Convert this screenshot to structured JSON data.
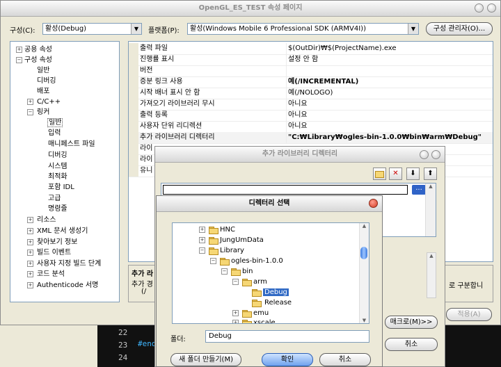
{
  "main_window": {
    "title": "OpenGL_ES_TEST 속성 페이지",
    "config_label": "구성(C):",
    "config_value": "활성(Debug)",
    "platform_label": "플랫폼(P):",
    "platform_value": "활성(Windows Mobile 6 Professional SDK (ARMV4I))",
    "config_manager_label": "구성 관리자(O)...",
    "apply_label": "적용(A)"
  },
  "tree": {
    "items": [
      {
        "label": "공용 속성",
        "toggle": "+"
      },
      {
        "label": "구성 속성",
        "toggle": "-"
      },
      {
        "label": "일반"
      },
      {
        "label": "디버깅"
      },
      {
        "label": "배포"
      },
      {
        "label": "C/C++",
        "toggle": "+"
      },
      {
        "label": "링커",
        "toggle": "-"
      },
      {
        "label": "일반"
      },
      {
        "label": "입력"
      },
      {
        "label": "매니페스트 파일"
      },
      {
        "label": "디버깅"
      },
      {
        "label": "시스템"
      },
      {
        "label": "최적화"
      },
      {
        "label": "포함 IDL"
      },
      {
        "label": "고급"
      },
      {
        "label": "명령줄"
      },
      {
        "label": "리소스",
        "toggle": "+"
      },
      {
        "label": "XML 문서 생성기",
        "toggle": "+"
      },
      {
        "label": "찾아보기 정보",
        "toggle": "+"
      },
      {
        "label": "빌드 이벤트",
        "toggle": "+"
      },
      {
        "label": "사용자 지정 빌드 단계",
        "toggle": "+"
      },
      {
        "label": "코드 분석",
        "toggle": "+"
      },
      {
        "label": "Authenticode 서명",
        "toggle": "+"
      }
    ]
  },
  "properties": [
    {
      "name": "출력 파일",
      "value": "$(OutDir)₩$(ProjectName).exe"
    },
    {
      "name": "진행률 표시",
      "value": "설정 안 함"
    },
    {
      "name": "버전",
      "value": ""
    },
    {
      "name": "증분 링크 사용",
      "value": "예(/INCREMENTAL)",
      "bold": true
    },
    {
      "name": "시작 배너 표시 안 함",
      "value": "예(/NOLOGO)"
    },
    {
      "name": "가져오기 라이브러리 무시",
      "value": "아니요"
    },
    {
      "name": "출력 등록",
      "value": "아니요"
    },
    {
      "name": "사용자 단위 리디렉션",
      "value": "아니요"
    },
    {
      "name": "추가 라이브러리 디렉터리",
      "value": "\"C:₩Library₩ogles-bin-1.0.0₩bin₩arm₩Debug\"",
      "bold": true
    },
    {
      "name": "라이",
      "value": ""
    },
    {
      "name": "라이",
      "value": ""
    },
    {
      "name": "유니",
      "value": ""
    }
  ],
  "description": {
    "title": "추가 라",
    "line1": "추가 경",
    "line2": "(/",
    "right_text": "로 구분합니"
  },
  "lib_dialog": {
    "title": "추가 라이브러리 디렉터리",
    "macro_label": "매크로(M)>>",
    "cancel_label": "취소",
    "browse_label": "..."
  },
  "folder_dialog": {
    "title": "디렉터리 선택",
    "folder_label": "폴더:",
    "folder_value": "Debug",
    "new_folder_label": "새 폴더 만들기(M)",
    "ok_label": "확인",
    "cancel_label": "취소",
    "nodes": [
      {
        "label": "HNC",
        "toggle": "+"
      },
      {
        "label": "JungUmData",
        "toggle": "+"
      },
      {
        "label": "Library",
        "toggle": "-"
      },
      {
        "label": "ogles-bin-1.0.0",
        "toggle": "-"
      },
      {
        "label": "bin",
        "toggle": "-"
      },
      {
        "label": "arm",
        "toggle": "-"
      },
      {
        "label": "Debug",
        "selected": true
      },
      {
        "label": "Release"
      },
      {
        "label": "emu",
        "toggle": "+"
      },
      {
        "label": "xscale",
        "toggle": "+"
      }
    ]
  },
  "code": {
    "line_numbers": [
      "22",
      "23",
      "24"
    ],
    "fragment": "#end"
  }
}
